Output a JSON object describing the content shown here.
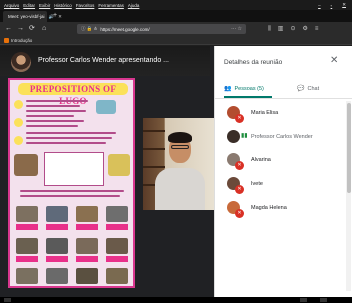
{
  "menubar": {
    "items": [
      "Arquivo",
      "Editar",
      "Exibir",
      "Histórico",
      "Favoritos",
      "Ferramentas",
      "Ajuda"
    ]
  },
  "window_controls": {
    "minimize": "–",
    "maximize": "▫",
    "close": "✕"
  },
  "tab": {
    "title": "Meet: yeo-visbf-jai",
    "audio_icon": "speaker-icon",
    "audio_glyph": "🔊",
    "close_glyph": "✕",
    "new_tab_glyph": "+"
  },
  "navbar": {
    "back": "←",
    "forward": "→",
    "reload": "⟳",
    "home": "⌂",
    "url": "https://meet.google.com/",
    "url_icons": "ⓘ 🔒 ⋔",
    "url_actions": "··· ☆",
    "toolbar": [
      "⫼",
      "▥",
      "⊙",
      "⚙",
      "≡"
    ]
  },
  "bookmarks": {
    "item": "Introdução"
  },
  "presenter": {
    "label": "Professor Carlos Wender apresentando ..."
  },
  "slide": {
    "title": "PREPOSITIONS OF LUGO"
  },
  "panel": {
    "title": "Detalhes da reunião",
    "close_glyph": "✕",
    "tabs": [
      {
        "label": "Pessoas (5)",
        "icon": "👥",
        "active": true
      },
      {
        "label": "Chat",
        "icon": "💬",
        "active": false
      }
    ],
    "people": [
      {
        "name": "Maria Elisa",
        "avatar_color": "#b34d2f",
        "muted": true,
        "presenting": false
      },
      {
        "name": "Professor Carlos Wender",
        "avatar_color": "#3a2e28",
        "muted": false,
        "presenting": true
      },
      {
        "name": "Alvarina",
        "avatar_color": "#8a7a70",
        "muted": true,
        "presenting": false
      },
      {
        "name": "Ivete",
        "avatar_color": "#6b4a3a",
        "muted": true,
        "presenting": false
      },
      {
        "name": "Magda Helena",
        "avatar_color": "#c86a3a",
        "muted": true,
        "presenting": false
      }
    ]
  },
  "colors": {
    "accent": "#00796b",
    "muted_red": "#d93025",
    "slide_pink": "#e8308a",
    "slide_yellow": "#fbe15a"
  }
}
